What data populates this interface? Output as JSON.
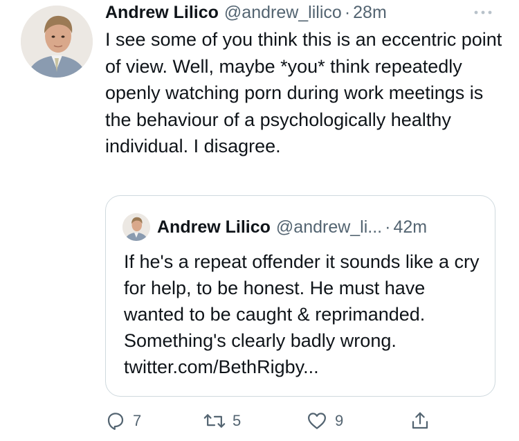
{
  "tweet": {
    "author_name": "Andrew Lilico",
    "handle": "@andrew_lilico",
    "separator": "·",
    "time": "28m",
    "text": "I see some of you think this is an eccentric point of view. Well, maybe *you* think repeatedly openly watching porn during work meetings is the behaviour of a psychologically healthy individual. I disagree."
  },
  "quoted_tweet": {
    "author_name": "Andrew Lilico",
    "handle": "@andrew_li...",
    "separator": "·",
    "time": "42m",
    "text": "If he's a repeat offender it sounds like a cry for help, to be honest. He must have wanted to be caught & reprimanded. Something's clearly badly wrong. twitter.com/BethRigby..."
  },
  "actions": {
    "reply_count": "7",
    "retweet_count": "5",
    "like_count": "9"
  },
  "icons": {
    "more": "more-horizontal-icon",
    "reply": "reply-icon",
    "retweet": "retweet-icon",
    "like": "heart-icon",
    "share": "share-icon"
  },
  "colors": {
    "text": "#0f1419",
    "secondary": "#536471",
    "border": "#cfd9de"
  }
}
